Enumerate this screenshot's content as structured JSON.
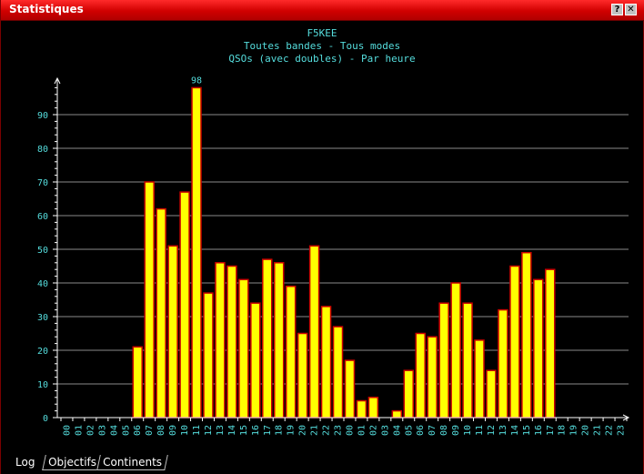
{
  "window": {
    "title": "Statistiques",
    "help_glyph": "?",
    "close_glyph": "✕"
  },
  "tabs": [
    {
      "label": "Log",
      "active": true
    },
    {
      "label": "Objectifs",
      "active": false
    },
    {
      "label": "Continents",
      "active": false
    }
  ],
  "colors": {
    "bar_fill": "#ffff00",
    "bar_edge": "#cc0000",
    "text": "#55dddd",
    "grid": "#8a8a8a",
    "axis": "#ffffff"
  },
  "chart_data": {
    "type": "bar",
    "title": "F5KEE",
    "subtitle_lines": [
      "Toutes bandes - Tous modes",
      "QSOs (avec doubles) - Par heure"
    ],
    "ylim": [
      0,
      100
    ],
    "yticks": [
      0,
      10,
      20,
      30,
      40,
      50,
      60,
      70,
      80,
      90
    ],
    "grid": true,
    "max_label": "98",
    "categories": [
      "00",
      "01",
      "02",
      "03",
      "04",
      "05",
      "06",
      "07",
      "08",
      "09",
      "10",
      "11",
      "12",
      "13",
      "14",
      "15",
      "16",
      "17",
      "18",
      "19",
      "20",
      "21",
      "22",
      "23",
      "00",
      "01",
      "02",
      "03",
      "04",
      "05",
      "06",
      "07",
      "08",
      "09",
      "10",
      "11",
      "12",
      "13",
      "14",
      "15",
      "16",
      "17",
      "18",
      "19",
      "20",
      "21",
      "22",
      "23"
    ],
    "values": [
      0,
      0,
      0,
      0,
      0,
      0,
      21,
      70,
      62,
      51,
      67,
      98,
      37,
      46,
      45,
      41,
      34,
      47,
      46,
      39,
      25,
      51,
      33,
      27,
      17,
      5,
      6,
      0,
      2,
      14,
      25,
      24,
      34,
      40,
      34,
      23,
      14,
      32,
      45,
      49,
      41,
      44,
      0,
      0,
      0,
      0,
      0,
      0
    ]
  }
}
